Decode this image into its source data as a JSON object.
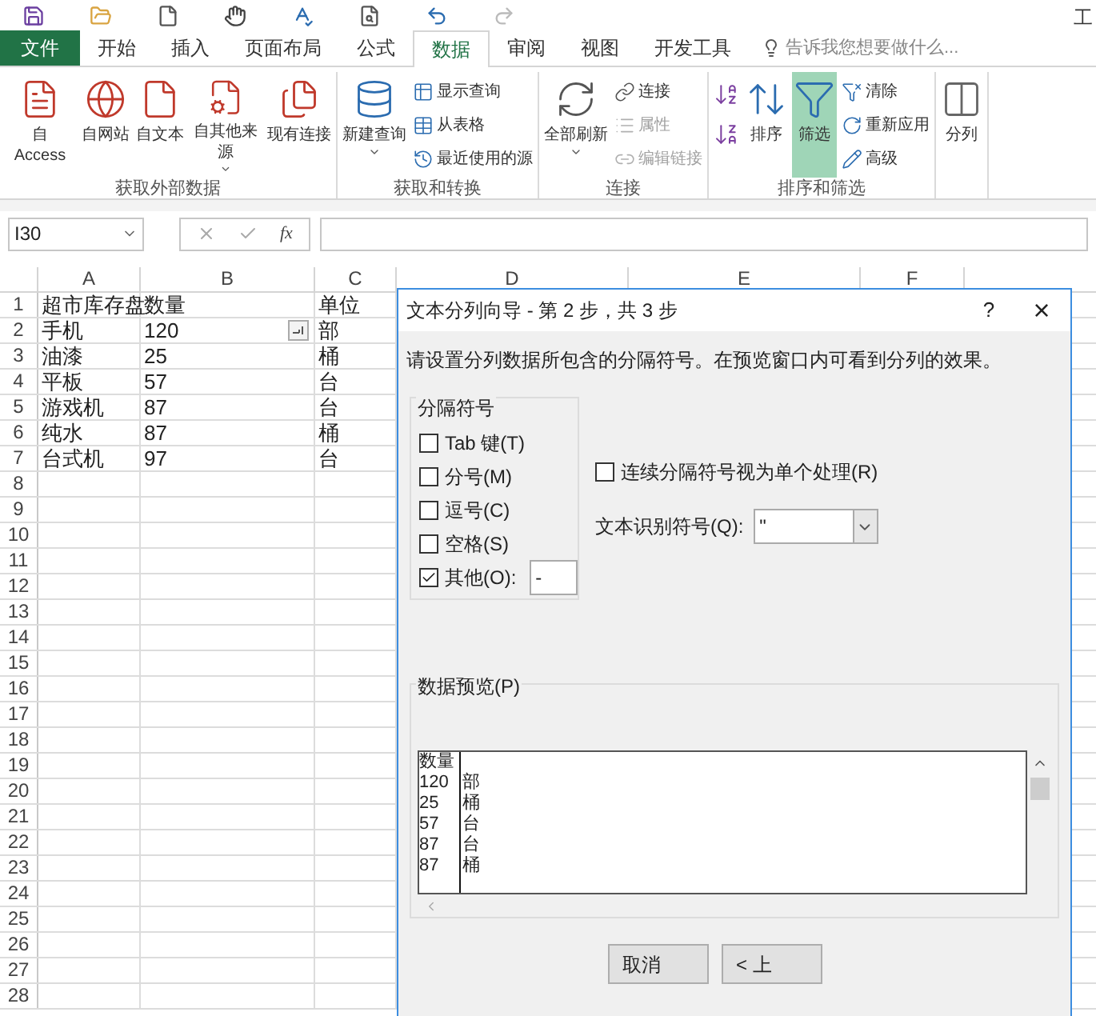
{
  "window": {
    "title": "工"
  },
  "tabs": [
    {
      "label": "文件",
      "kind": "file",
      "selected": false
    },
    {
      "label": "开始",
      "kind": "tab",
      "selected": false
    },
    {
      "label": "插入",
      "kind": "tab",
      "selected": false
    },
    {
      "label": "页面布局",
      "kind": "tab",
      "selected": false
    },
    {
      "label": "公式",
      "kind": "tab",
      "selected": false
    },
    {
      "label": "数据",
      "kind": "tab",
      "selected": true
    },
    {
      "label": "审阅",
      "kind": "tab",
      "selected": false
    },
    {
      "label": "视图",
      "kind": "tab",
      "selected": false
    },
    {
      "label": "开发工具",
      "kind": "tab",
      "selected": false
    }
  ],
  "tell_me": {
    "placeholder": "告诉我您想要做什么..."
  },
  "ribbon_groups": [
    {
      "label": "获取外部数据",
      "items": [
        {
          "label": "自 Access",
          "kind": "large",
          "on": false,
          "disabled": false,
          "dropdown": false
        },
        {
          "label": "自网站",
          "kind": "large",
          "on": false,
          "disabled": false,
          "dropdown": false
        },
        {
          "label": "自文本",
          "kind": "large",
          "on": false,
          "disabled": false,
          "dropdown": false
        },
        {
          "label": "自其他来源",
          "kind": "large",
          "on": false,
          "disabled": false,
          "dropdown": true
        },
        {
          "label": "现有连接",
          "kind": "large",
          "on": false,
          "disabled": false,
          "dropdown": false
        }
      ]
    },
    {
      "label": "获取和转换",
      "items": [
        {
          "label": "新建查询",
          "kind": "large",
          "on": false,
          "disabled": false,
          "dropdown": true
        },
        {
          "label": "显示查询",
          "kind": "small",
          "on": false,
          "disabled": false,
          "dropdown": false
        },
        {
          "label": "从表格",
          "kind": "small",
          "on": false,
          "disabled": false,
          "dropdown": false
        },
        {
          "label": "最近使用的源",
          "kind": "small",
          "on": false,
          "disabled": false,
          "dropdown": false
        }
      ]
    },
    {
      "label": "连接",
      "items": [
        {
          "label": "全部刷新",
          "kind": "large",
          "on": false,
          "disabled": false,
          "dropdown": true
        },
        {
          "label": "连接",
          "kind": "small",
          "on": false,
          "disabled": false,
          "dropdown": false
        },
        {
          "label": "属性",
          "kind": "small",
          "on": false,
          "disabled": true,
          "dropdown": false
        },
        {
          "label": "编辑链接",
          "kind": "small",
          "on": false,
          "disabled": true,
          "dropdown": false
        }
      ]
    },
    {
      "label": "排序和筛选",
      "items": [
        {
          "kind": "icon"
        },
        {
          "kind": "icon"
        },
        {
          "label": "排序",
          "kind": "large",
          "on": false,
          "disabled": false,
          "dropdown": false
        },
        {
          "label": "筛选",
          "kind": "large",
          "on": true,
          "disabled": false,
          "dropdown": false
        },
        {
          "label": "清除",
          "kind": "small",
          "on": false,
          "disabled": false,
          "dropdown": false
        },
        {
          "label": "重新应用",
          "kind": "small",
          "on": false,
          "disabled": false,
          "dropdown": false
        },
        {
          "label": "高级",
          "kind": "small",
          "on": false,
          "disabled": false,
          "dropdown": false
        }
      ]
    },
    {
      "items": [
        {
          "label": "分列",
          "kind": "large"
        }
      ]
    }
  ],
  "formula_bar": {
    "name_box": "I30",
    "function_label": "fx"
  },
  "sheet": {
    "columns": [
      "A",
      "B",
      "C",
      "D",
      "E",
      "F"
    ],
    "rows": [
      {
        "header": "1",
        "cells": [
          "超市库存盘",
          "数量",
          "单位"
        ]
      },
      {
        "header": "2",
        "cells": [
          "手机",
          "120",
          "部"
        ]
      },
      {
        "header": "3",
        "cells": [
          "油漆",
          "25",
          "桶"
        ]
      },
      {
        "header": "4",
        "cells": [
          "平板",
          "57",
          "台"
        ]
      },
      {
        "header": "5",
        "cells": [
          "游戏机",
          "87",
          "台"
        ]
      },
      {
        "header": "6",
        "cells": [
          "纯水",
          "87",
          "桶"
        ]
      },
      {
        "header": "7",
        "cells": [
          "台式机",
          "97",
          "台"
        ]
      },
      {
        "header": "8",
        "cells": []
      },
      {
        "header": "9",
        "cells": []
      },
      {
        "header": "10",
        "cells": []
      },
      {
        "header": "11",
        "cells": []
      },
      {
        "header": "12",
        "cells": []
      },
      {
        "header": "13",
        "cells": []
      },
      {
        "header": "14",
        "cells": []
      },
      {
        "header": "15",
        "cells": []
      },
      {
        "header": "16",
        "cells": []
      },
      {
        "header": "17",
        "cells": []
      },
      {
        "header": "18",
        "cells": []
      },
      {
        "header": "19",
        "cells": []
      },
      {
        "header": "20",
        "cells": []
      },
      {
        "header": "21",
        "cells": []
      },
      {
        "header": "22",
        "cells": []
      },
      {
        "header": "23",
        "cells": []
      },
      {
        "header": "24",
        "cells": []
      },
      {
        "header": "25",
        "cells": []
      },
      {
        "header": "26",
        "cells": []
      },
      {
        "header": "27",
        "cells": []
      },
      {
        "header": "28",
        "cells": []
      }
    ]
  },
  "dialog": {
    "title": "文本分列向导 - 第 2 步，共 3 步",
    "help": "?",
    "close": "×",
    "instruction": "请设置分列数据所包含的分隔符号。在预览窗口内可看到分列的效果。",
    "delimiters": {
      "label": "分隔符号",
      "options": [
        {
          "label": "Tab 键(T)",
          "checked": false
        },
        {
          "label": "分号(M)",
          "checked": false
        },
        {
          "label": "逗号(C)",
          "checked": false
        },
        {
          "label": "空格(S)",
          "checked": false
        },
        {
          "label": "其他(O):",
          "checked": true,
          "value": "-"
        }
      ]
    },
    "consecutive": {
      "label": "连续分隔符号视为单个处理(R)",
      "checked": false
    },
    "qualifier": {
      "label": "文本识别符号(Q):",
      "value": "\""
    },
    "preview": {
      "label": "数据预览(P)",
      "rows": [
        [
          "数量"
        ],
        [
          "120",
          "部"
        ],
        [
          "25",
          "桶"
        ],
        [
          "57",
          "台"
        ],
        [
          "87",
          "台"
        ],
        [
          "87",
          "桶"
        ]
      ]
    },
    "buttons": [
      "取消",
      "< 上"
    ]
  }
}
